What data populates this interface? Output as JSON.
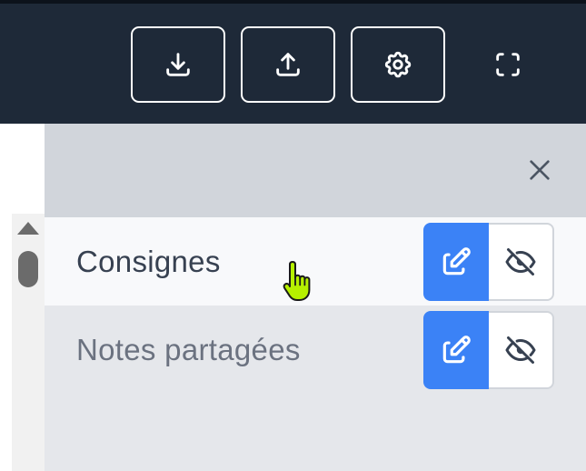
{
  "toolbar": {
    "buttons": [
      {
        "icon": "download-icon"
      },
      {
        "icon": "upload-icon"
      },
      {
        "icon": "gear-icon"
      }
    ],
    "fullscreen_icon": "fullscreen-icon"
  },
  "panel": {
    "close_icon": "close-icon",
    "items": [
      {
        "label": "Consignes",
        "edit_icon": "edit-icon",
        "visibility_icon": "eye-off-icon",
        "highlighted": true
      },
      {
        "label": "Notes partagées",
        "edit_icon": "edit-icon",
        "visibility_icon": "eye-off-icon",
        "highlighted": false
      }
    ]
  },
  "colors": {
    "topbar": "#1e2938",
    "panel": "#e5e7eb",
    "panel_header": "#d1d5db",
    "accent": "#3b82f6",
    "cursor": "#b6f000"
  }
}
